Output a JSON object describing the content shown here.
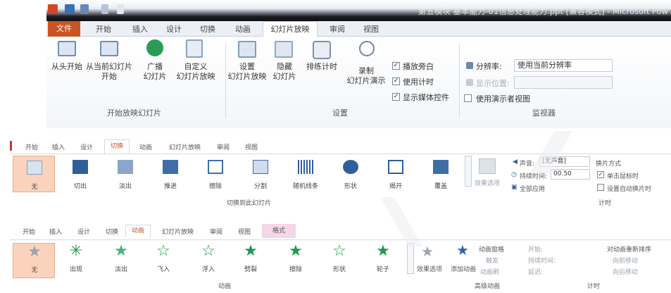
{
  "ribbon1": {
    "title": "第五模块 基本能力-01信息处理能力.ppt [兼容模式] - Microsoft Pow",
    "tabs": [
      "文件",
      "开始",
      "插入",
      "设计",
      "切换",
      "动画",
      "幻灯片放映",
      "审阅",
      "视图"
    ],
    "active_tab": "幻灯片放映",
    "buttons": {
      "from_start": "从头开始",
      "from_current": "从当前幻灯片",
      "from_current_2": "开始",
      "broadcast": "广播",
      "broadcast_2": "幻灯片",
      "custom": "自定义",
      "custom_2": "幻灯片放映",
      "setup": "设置",
      "setup_2": "幻灯片放映",
      "hide": "隐藏",
      "hide_2": "幻灯片",
      "rehearse": "排练计时",
      "record": "录制",
      "record_2": "幻灯片演示"
    },
    "checkboxes": [
      {
        "label": "播放旁白",
        "checked": true
      },
      {
        "label": "使用计时",
        "checked": true
      },
      {
        "label": "显示媒体控件",
        "checked": true
      }
    ],
    "monitor": {
      "resolution_label": "分辨率:",
      "resolution_value": "使用当前分辨率",
      "show_on_label": "显示位置:",
      "presenter_view": "使用演示者视图"
    },
    "groups": [
      "开始放映幻灯片",
      "设置",
      "监视器"
    ]
  },
  "ribbon2": {
    "tabs": [
      "开始",
      "插入",
      "设计",
      "切换",
      "动画",
      "幻灯片放映",
      "审阅",
      "视图"
    ],
    "active_tab": "切换",
    "transitions": [
      "无",
      "切出",
      "淡出",
      "推进",
      "擦除",
      "分割",
      "随机线条",
      "形状",
      "揭开",
      "覆盖"
    ],
    "effect_options": "效果选项",
    "group_label": "切换到此幻灯片",
    "timing": {
      "sound_label": "声音:",
      "sound_value": "[无声音]",
      "duration_label": "持续时间:",
      "duration_value": "00.50",
      "apply_all": "全部应用",
      "advance_header": "换片方式",
      "on_click": "单击鼠标时",
      "on_click_checked": true,
      "auto_after": "设置自动换片时",
      "group": "计时"
    }
  },
  "ribbon3": {
    "tabs": [
      "开始",
      "插入",
      "设计",
      "切换",
      "动画",
      "幻灯片放映",
      "审阅",
      "视图",
      "格式"
    ],
    "active_tab": "动画",
    "animations": [
      "无",
      "出现",
      "淡出",
      "飞入",
      "浮入",
      "劈裂",
      "擦除",
      "形状",
      "轮子"
    ],
    "effect_options": "效果选项",
    "add_animation": "添加动画",
    "pane": "动画窗格",
    "trigger": "触发",
    "painter": "动画刷",
    "start_label": "开始:",
    "duration_label": "持续时间:",
    "delay_label": "延迟:",
    "reorder": "对动画重新排序",
    "move_earlier": "向前移动",
    "move_later": "向后移动",
    "group_anim": "动画",
    "group_adv": "高级动画",
    "group_timing": "计时"
  },
  "colors": {
    "accent": "#c9541f",
    "title_dark": "#14161b",
    "tab_bg": "#eceff4",
    "star_green": "#1f9a4b",
    "star_gray": "#9aa2ab"
  }
}
